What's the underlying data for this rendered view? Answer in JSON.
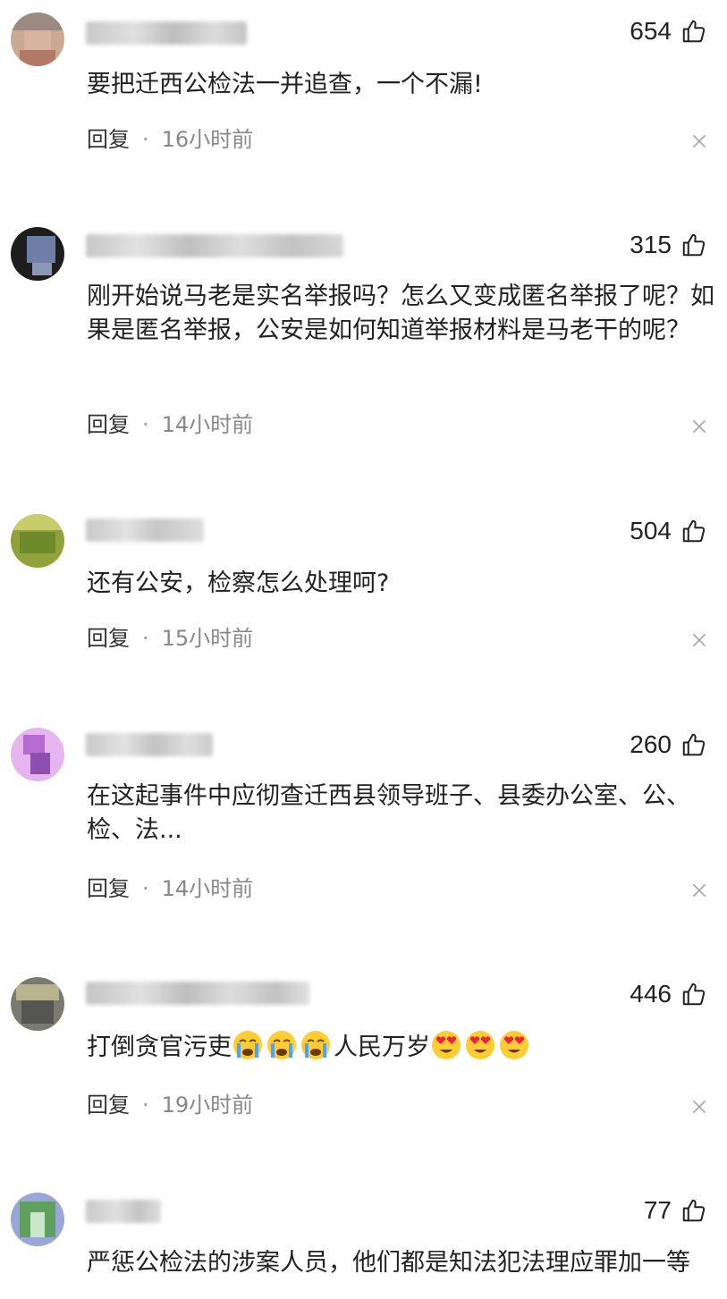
{
  "reply_label": "回复",
  "dot": "·",
  "comments": [
    {
      "likes": "654",
      "text": "要把迁西公检法一并追查，一个不漏!",
      "time": "16小时前"
    },
    {
      "likes": "315",
      "text": "刚开始说马老是实名举报吗？怎么又变成匿名举报了呢？如果是匿名举报，公安是如何知道举报材料是马老干的呢？",
      "time": "14小时前"
    },
    {
      "likes": "504",
      "text": "还有公安，检察怎么处理呵?",
      "time": "15小时前"
    },
    {
      "likes": "260",
      "text": "在这起事件中应彻查迁西县领导班子、县委办公室、公、检、法...",
      "time": "14小时前"
    },
    {
      "likes": "446",
      "text_prefix": "打倒贪官污吏",
      "text_suffix": "人民万岁",
      "emojis_a": [
        "crying-face",
        "crying-face",
        "crying-face"
      ],
      "emojis_b": [
        "heart-eyes-face",
        "heart-eyes-face",
        "heart-eyes-face"
      ],
      "time": "19小时前"
    },
    {
      "likes": "77",
      "text": "严惩公检法的涉案人员，他们都是知法犯法理应罪加一等"
    }
  ]
}
